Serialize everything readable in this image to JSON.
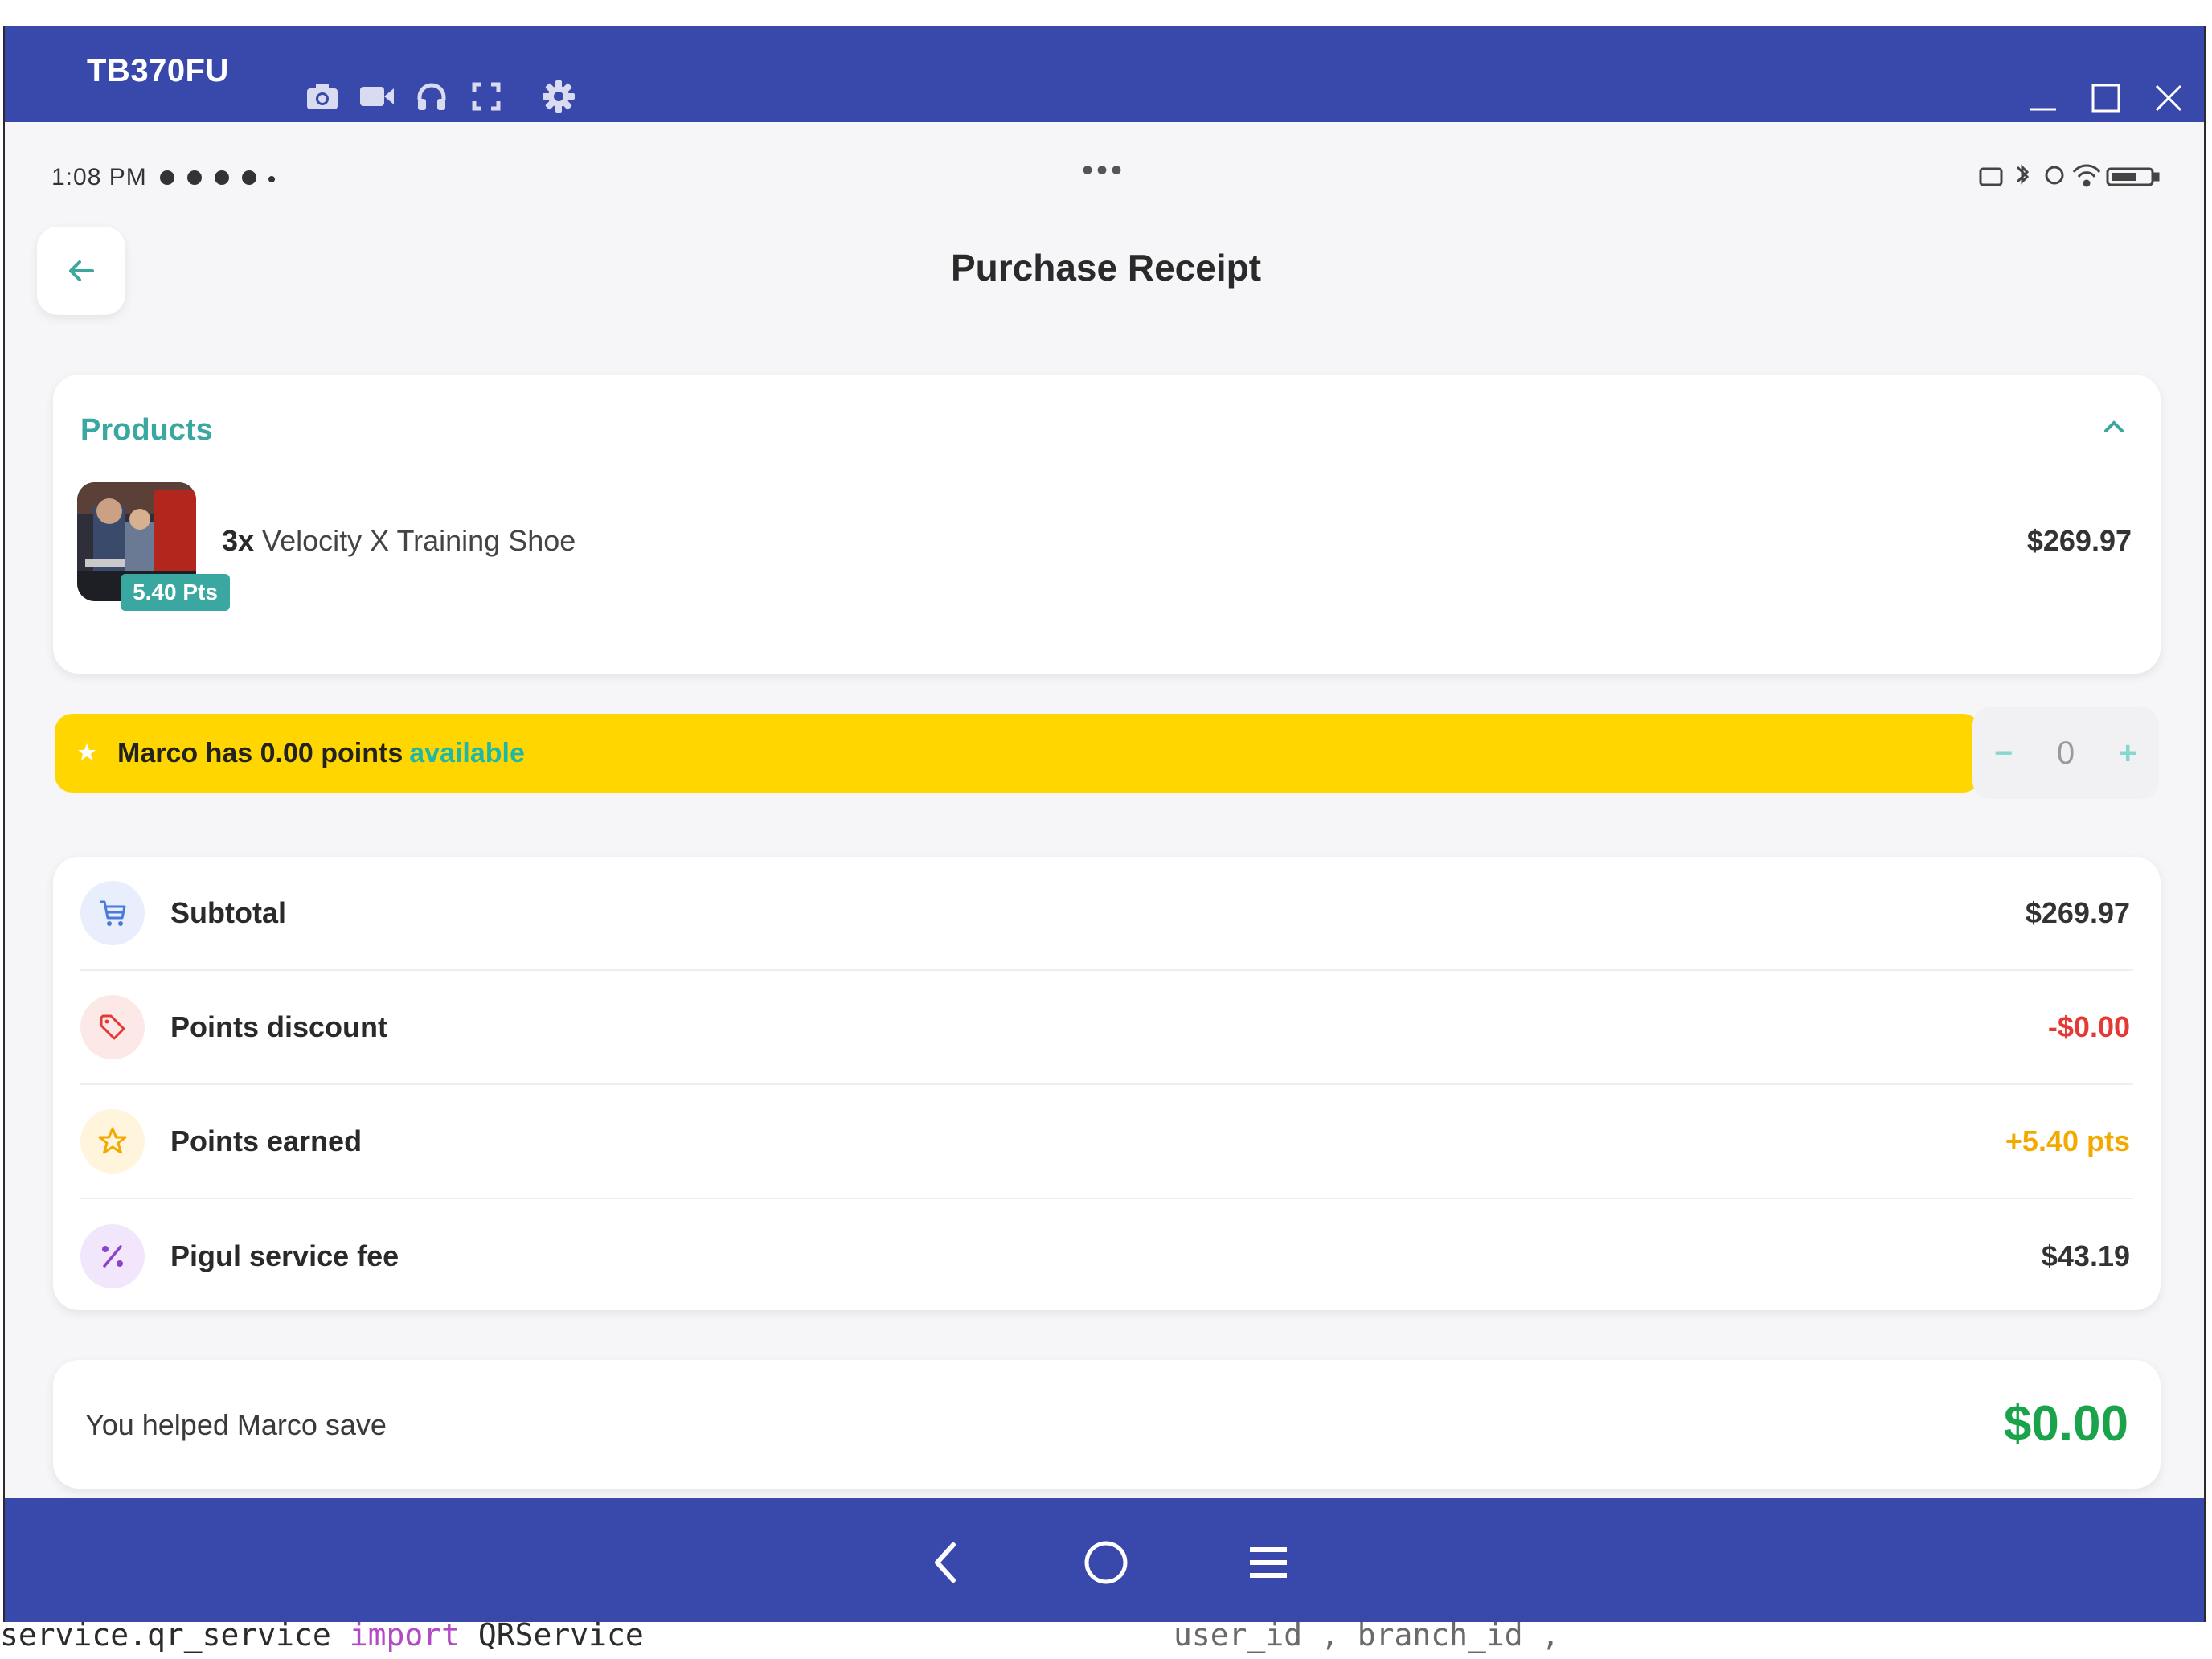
{
  "background_code": {
    "left_prefix": "service.qr_service ",
    "left_keyword": "import",
    "left_suffix": " QRService",
    "right_text": "user_id , branch_id ,"
  },
  "emulator": {
    "device_name": "TB370FU",
    "toolbar_icons": [
      "camera-icon",
      "video-icon",
      "headphones-icon",
      "fullscreen-icon",
      "gear-icon"
    ],
    "window_controls": [
      "minimize-icon",
      "maximize-icon",
      "close-icon"
    ]
  },
  "status_bar": {
    "time": "1:08 PM",
    "center_dots": "•••"
  },
  "header": {
    "title": "Purchase Receipt"
  },
  "products": {
    "title": "Products",
    "items": [
      {
        "qty": "3x",
        "name": "Velocity X Training Shoe",
        "price": "$269.97",
        "badge": "5.40 Pts"
      }
    ]
  },
  "points_banner": {
    "text": "Marco has 0.00 points",
    "highlight": "available",
    "stepper": {
      "minus": "−",
      "value": "0",
      "plus": "+"
    }
  },
  "summary": {
    "rows": [
      {
        "label": "Subtotal",
        "value": "$269.97",
        "icon": "cart-icon",
        "value_color": "#333333"
      },
      {
        "label": "Points discount",
        "value": "-$0.00",
        "icon": "tag-icon",
        "value_color": "#e53935"
      },
      {
        "label": "Points earned",
        "value": "+5.40 pts",
        "icon": "star-icon",
        "value_color": "#f2a900"
      },
      {
        "label": "Pigul service fee",
        "value": "$43.19",
        "icon": "percent-icon",
        "value_color": "#333333"
      }
    ]
  },
  "savings": {
    "label": "You helped Marco save",
    "value": "$0.00",
    "value_color": "#1aa34a"
  },
  "colors": {
    "title_bar": "#3949ab",
    "accent_teal": "#3aa7a0",
    "banner_yellow": "#ffd600"
  }
}
